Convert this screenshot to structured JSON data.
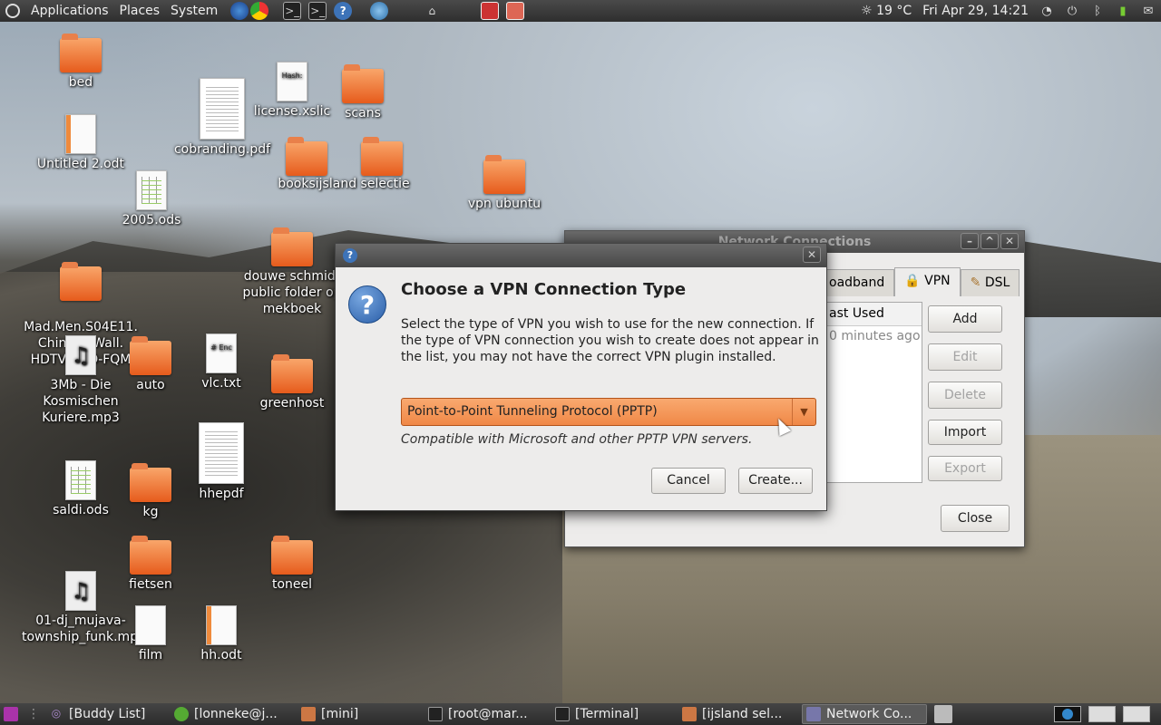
{
  "top_panel": {
    "menus": [
      "Applications",
      "Places",
      "System"
    ],
    "weather": "19 °C",
    "clock": "Fri Apr 29, 14:21"
  },
  "desktop_icons": [
    {
      "label": "bed",
      "type": "folder"
    },
    {
      "label": "Untitled 2.odt",
      "type": "odt"
    },
    {
      "label": "2005.ods",
      "type": "ods"
    },
    {
      "label": "Mad.Men.S04E11.\nChinese.Wall.\nHDTV.XviD-FQM",
      "type": "folder"
    },
    {
      "label": "3Mb - Die Kosmischen Kuriere.mp3",
      "type": "mp3"
    },
    {
      "label": "auto",
      "type": "folder"
    },
    {
      "label": "vlc.txt",
      "type": "txt"
    },
    {
      "label": "saldi.ods",
      "type": "ods"
    },
    {
      "label": "kg",
      "type": "folder"
    },
    {
      "label": "hhepdf",
      "type": "pdf"
    },
    {
      "label": "fietsen",
      "type": "folder"
    },
    {
      "label": "01-dj_mujava-township_funk.mp3",
      "type": "mp3"
    },
    {
      "label": "film",
      "type": "txt"
    },
    {
      "label": "hh.odt",
      "type": "odt"
    },
    {
      "label": "cobranding.pdf",
      "type": "pdf"
    },
    {
      "label": "license.xslic",
      "type": "txt"
    },
    {
      "label": "scans",
      "type": "folder"
    },
    {
      "label": "booksijsland selectie",
      "type": "folder"
    },
    {
      "label": "douwe schmidt public folder op mekboek",
      "type": "folder"
    },
    {
      "label": "greenhost",
      "type": "folder"
    },
    {
      "label": "toneel",
      "type": "folder"
    },
    {
      "label": "vpn ubuntu",
      "type": "folder"
    }
  ],
  "network_window": {
    "title": "Network Connections",
    "tabs": [
      "oadband",
      "VPN",
      "DSL"
    ],
    "list_header": "ast Used",
    "list_row": "0 minutes ago",
    "buttons": {
      "add": "Add",
      "edit": "Edit",
      "delete": "Delete",
      "import": "Import",
      "export": "Export",
      "close": "Close"
    }
  },
  "vpn_dialog": {
    "heading": "Choose a VPN Connection Type",
    "description": "Select the type of VPN you wish to use for the new connection.  If the type of VPN connection you wish to create does not appear in the list, you may not have the correct VPN plugin installed.",
    "selected_type": "Point-to-Point Tunneling Protocol (PPTP)",
    "hint": "Compatible with Microsoft and other PPTP VPN servers.",
    "cancel": "Cancel",
    "create": "Create..."
  },
  "taskbar": [
    {
      "label": "[Buddy List]",
      "active": false
    },
    {
      "label": "[lonneke@j...",
      "active": false
    },
    {
      "label": "[mini]",
      "active": false
    },
    {
      "label": "[root@mar...",
      "active": false
    },
    {
      "label": "[Terminal]",
      "active": false
    },
    {
      "label": "[ijsland sel...",
      "active": false
    },
    {
      "label": "Network Co...",
      "active": true
    }
  ]
}
